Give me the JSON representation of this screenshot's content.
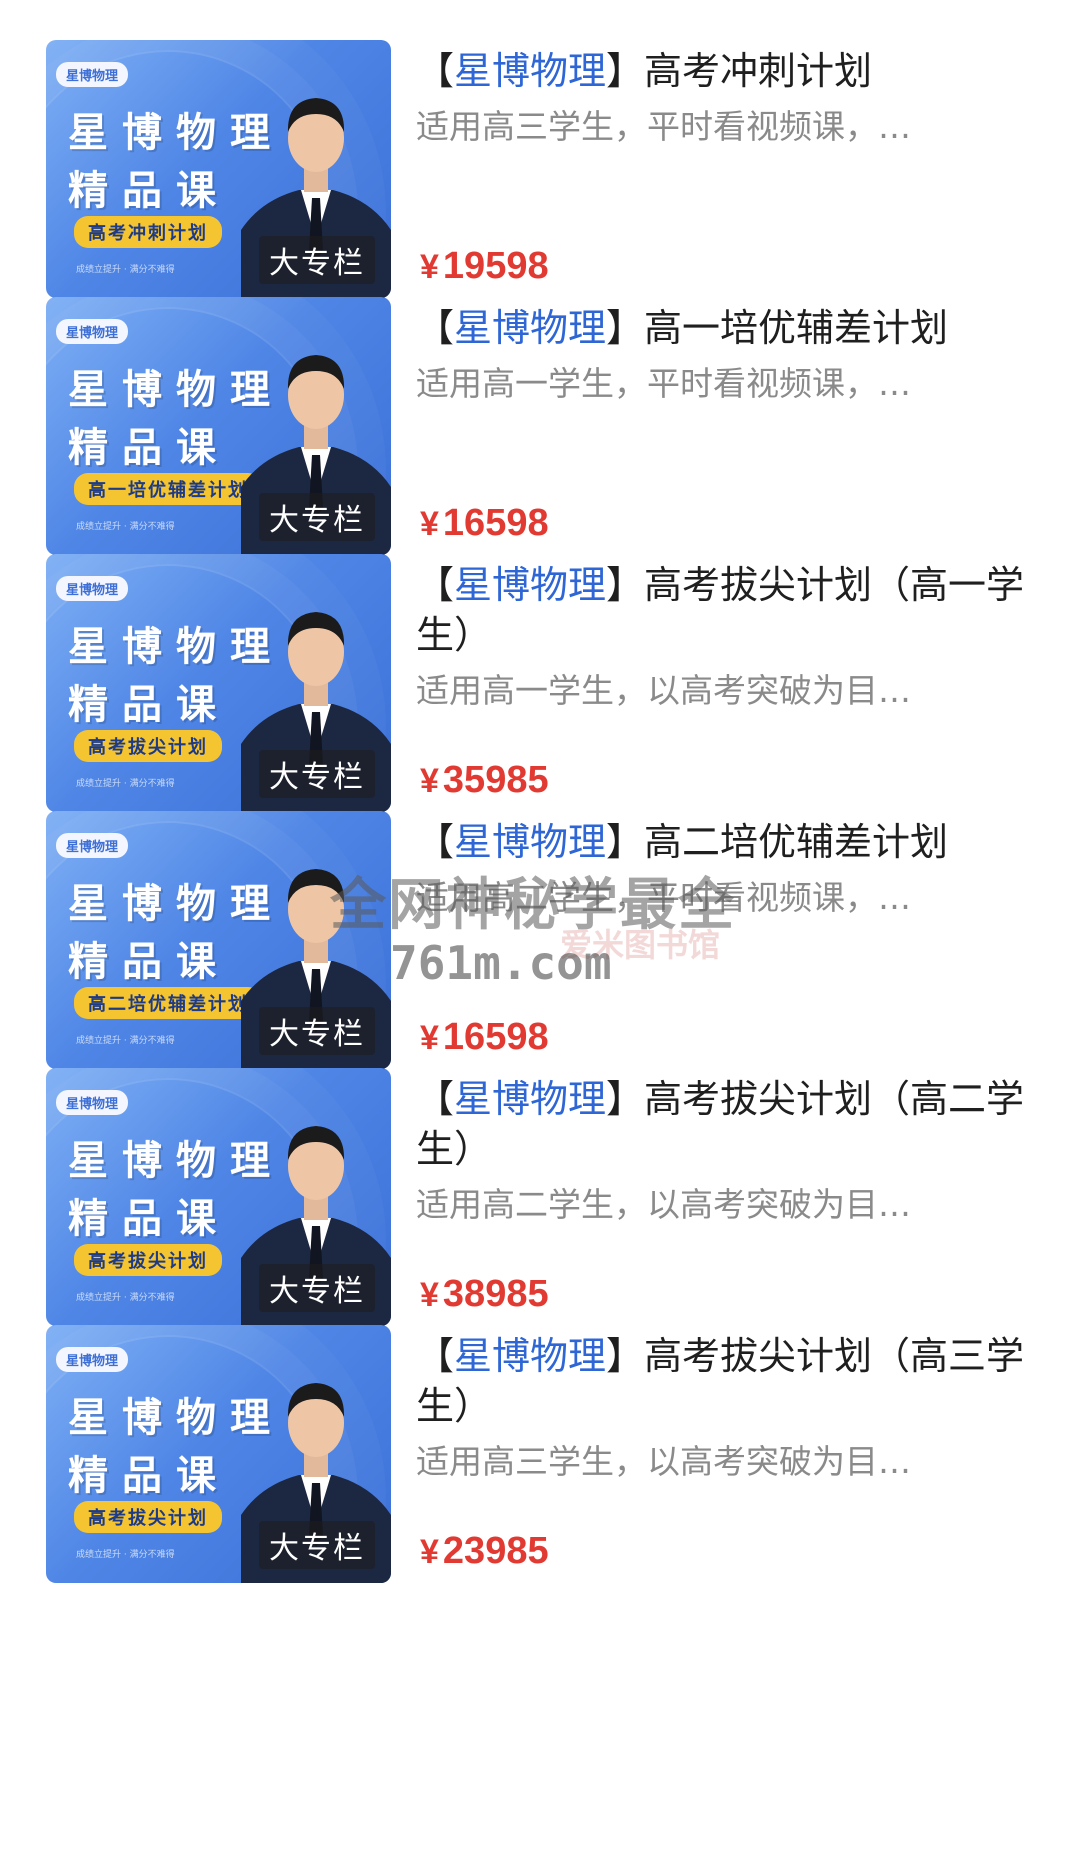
{
  "items": [
    {
      "thumb": {
        "logo": "星博物理",
        "line1": "星博物理",
        "line2": "精品课",
        "plan": "高考冲刺计划",
        "badge": "大专栏",
        "tiny": "成绩立提升 · 满分不难得"
      },
      "title_prefix": "【",
      "title_brand": "星博物理",
      "title_suffix": "】",
      "title_rest": "高考冲刺计划",
      "desc": "适用高三学生，平时看视频课，…",
      "price_symbol": "¥",
      "price": "19598"
    },
    {
      "thumb": {
        "logo": "星博物理",
        "line1": "星博物理",
        "line2": "精品课",
        "plan": "高一培优辅差计划",
        "badge": "大专栏",
        "tiny": "成绩立提升 · 满分不难得"
      },
      "title_prefix": "【",
      "title_brand": "星博物理",
      "title_suffix": "】",
      "title_rest": "高一培优辅差计划",
      "desc": "适用高一学生，平时看视频课，…",
      "price_symbol": "¥",
      "price": "16598"
    },
    {
      "thumb": {
        "logo": "星博物理",
        "line1": "星博物理",
        "line2": "精品课",
        "plan": "高考拔尖计划",
        "badge": "大专栏",
        "tiny": "成绩立提升 · 满分不难得"
      },
      "title_prefix": "【",
      "title_brand": "星博物理",
      "title_suffix": "】",
      "title_rest": "高考拔尖计划（高一学生）",
      "desc": "适用高一学生，以高考突破为目…",
      "price_symbol": "¥",
      "price": "35985"
    },
    {
      "thumb": {
        "logo": "星博物理",
        "line1": "星博物理",
        "line2": "精品课",
        "plan": "高二培优辅差计划",
        "badge": "大专栏",
        "tiny": "成绩立提升 · 满分不难得"
      },
      "title_prefix": "【",
      "title_brand": "星博物理",
      "title_suffix": "】",
      "title_rest": "高二培优辅差计划",
      "desc": "适用高二学生，平时看视频课，…",
      "price_symbol": "¥",
      "price": "16598"
    },
    {
      "thumb": {
        "logo": "星博物理",
        "line1": "星博物理",
        "line2": "精品课",
        "plan": "高考拔尖计划",
        "badge": "大专栏",
        "tiny": "成绩立提升 · 满分不难得"
      },
      "title_prefix": "【",
      "title_brand": "星博物理",
      "title_suffix": "】",
      "title_rest": "高考拔尖计划（高二学生）",
      "desc": "适用高二学生，以高考突破为目…",
      "price_symbol": "¥",
      "price": "38985"
    },
    {
      "thumb": {
        "logo": "星博物理",
        "line1": "星博物理",
        "line2": "精品课",
        "plan": "高考拔尖计划",
        "badge": "大专栏",
        "tiny": "成绩立提升 · 满分不难得"
      },
      "title_prefix": "【",
      "title_brand": "星博物理",
      "title_suffix": "】",
      "title_rest": "高考拔尖计划（高三学生）",
      "desc": "适用高三学生，以高考突破为目…",
      "price_symbol": "¥",
      "price": "23985"
    }
  ],
  "watermark": {
    "line1": "全网神秘学最全",
    "line2": "761m.com",
    "line3": "爱米图书馆"
  },
  "colors": {
    "brand_blue": "#2e66d6",
    "price_red": "#e13a32",
    "desc_gray": "#8a8a8a",
    "tag_yellow": "#f5c431"
  }
}
